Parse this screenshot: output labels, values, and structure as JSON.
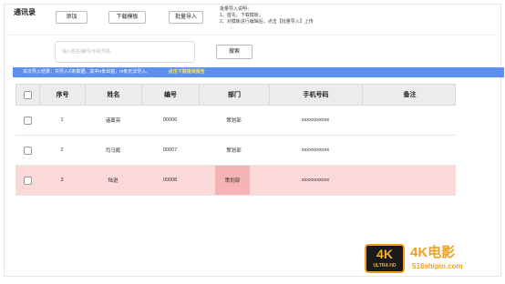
{
  "header": {
    "title": "通讯录",
    "add_label": "添加",
    "download_label": "下载模板",
    "import_label": "批量导入",
    "hint_title": "批量导入说明：",
    "hint_step1": "1、首先，下载模板；",
    "hint_step2": "2、对模板进行编辑后，点击【批量导入】上传"
  },
  "search": {
    "placeholder": "输入姓名/编号/手机号码",
    "button_label": "搜索"
  },
  "banner": {
    "text": "本次导入结果：共导入X条数据。其中n条出错，m条无法导入。",
    "link": "点击下载错误报告"
  },
  "table": {
    "columns": [
      "序号",
      "姓名",
      "编号",
      "部门",
      "手机号码",
      "备注"
    ],
    "rows": [
      {
        "index": "1",
        "name": "诸葛亮",
        "code": "00006",
        "dept": "策划部",
        "phone": "xxxxxxxxxxx",
        "note": ""
      },
      {
        "index": "2",
        "name": "司马懿",
        "code": "00007",
        "dept": "策划部",
        "phone": "xxxxxxxxxxx",
        "note": ""
      },
      {
        "index": "3",
        "name": "陆逊",
        "code": "00008",
        "dept": "策划部",
        "phone": "xxxxxxxxxxx",
        "note": ""
      }
    ]
  },
  "watermark": {
    "badge_big": "4K",
    "badge_small": "ULTRA HD",
    "brand": "4K电影",
    "url": "518shipin.com"
  },
  "colors": {
    "banner": "#5b8ff0",
    "highlight_row": "#fbd9d9",
    "highlight_cell": "#f5b4b4",
    "watermark": "#f0a020"
  }
}
